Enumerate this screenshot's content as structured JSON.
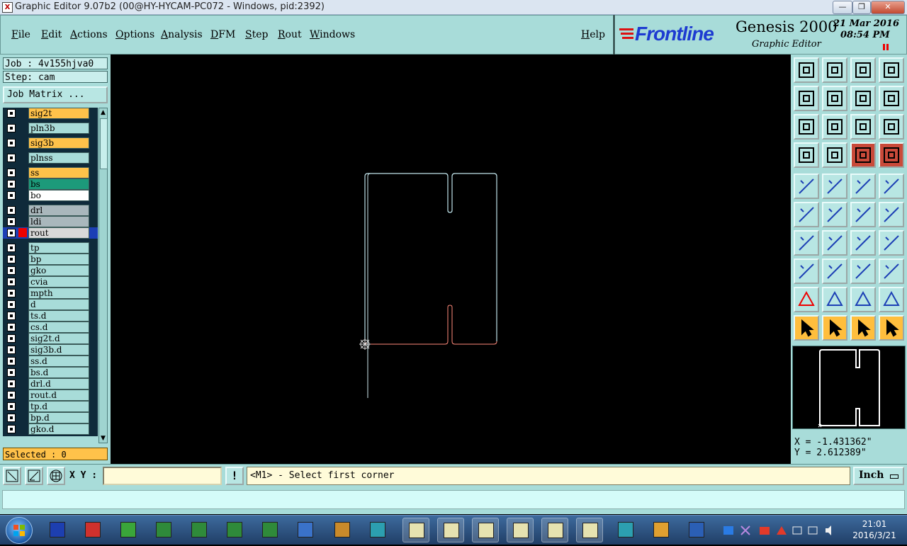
{
  "window": {
    "title": "Graphic Editor 9.07b2 (00@HY-HYCAM-PC072 - Windows, pid:2392)",
    "minimize": "—",
    "maximize": "❐",
    "close": "✕"
  },
  "menu": {
    "items": [
      "File",
      "Edit",
      "Actions",
      "Options",
      "Analysis",
      "DFM",
      "Step",
      "Rout",
      "Windows"
    ],
    "help": "Help"
  },
  "brand": {
    "logo": "Frontline",
    "product": "Genesis 2000",
    "subtitle": "Graphic Editor",
    "date": "21 Mar 2016",
    "time": "08:54 PM"
  },
  "job": {
    "job_label": "Job : 4v155hjva0",
    "step_label": "Step: cam",
    "matrix_button": "Job Matrix ..."
  },
  "layers": [
    {
      "name": "sig2t",
      "color": "#ffc24a"
    },
    {
      "name": "pln3b",
      "color": "#a8dcd9"
    },
    {
      "name": "sig3b",
      "color": "#ffc24a"
    },
    {
      "name": "plnss",
      "color": "#a8dcd9"
    },
    {
      "name": "ss",
      "color": "#ffc24a"
    },
    {
      "name": "bs",
      "color": "#1c9a7a"
    },
    {
      "name": "bo",
      "color": "#ffffff"
    },
    {
      "name": "drl",
      "color": "#a9b7bc"
    },
    {
      "name": "ldi",
      "color": "#a9b7bc"
    },
    {
      "name": "rout",
      "color": "#d8d8d8"
    },
    {
      "name": "tp",
      "color": "#a8dcd9"
    },
    {
      "name": "bp",
      "color": "#a8dcd9"
    },
    {
      "name": "gko",
      "color": "#a8dcd9"
    },
    {
      "name": "cvia",
      "color": "#a8dcd9"
    },
    {
      "name": "mpth",
      "color": "#a8dcd9"
    },
    {
      "name": "d",
      "color": "#a8dcd9"
    },
    {
      "name": "ts.d",
      "color": "#a8dcd9"
    },
    {
      "name": "cs.d",
      "color": "#a8dcd9"
    },
    {
      "name": "sig2t.d",
      "color": "#a8dcd9"
    },
    {
      "name": "sig3b.d",
      "color": "#a8dcd9"
    },
    {
      "name": "ss.d",
      "color": "#a8dcd9"
    },
    {
      "name": "bs.d",
      "color": "#a8dcd9"
    },
    {
      "name": "drl.d",
      "color": "#a8dcd9"
    },
    {
      "name": "rout.d",
      "color": "#a8dcd9"
    },
    {
      "name": "tp.d",
      "color": "#a8dcd9"
    },
    {
      "name": "bp.d",
      "color": "#a8dcd9"
    },
    {
      "name": "gko.d",
      "color": "#a8dcd9"
    }
  ],
  "selected": "Selected : 0",
  "coords": {
    "x": "X = -1.431362\"",
    "y": "Y = 2.612389\""
  },
  "input": {
    "xy_label": "X Y :",
    "xy_value": "",
    "alert_icon": "!",
    "prompt": "<M1> - Select first corner",
    "unit": "Inch"
  },
  "taskbar": {
    "time": "21:01",
    "date": "2016/3/21"
  }
}
